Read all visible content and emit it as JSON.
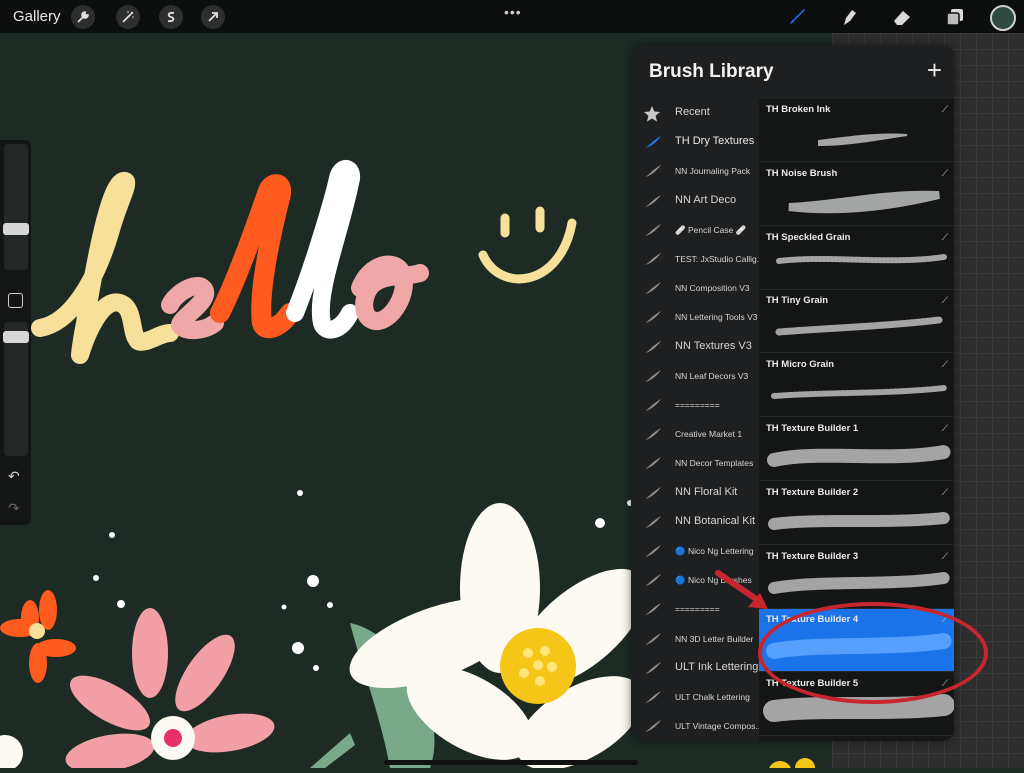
{
  "topbar": {
    "gallery_label": "Gallery",
    "left_icons": [
      "wrench-icon",
      "magic-wand-icon",
      "selection-s-icon",
      "transform-arrow-icon"
    ],
    "more_label": "•••",
    "right_icons": [
      "brush-icon",
      "smudge-icon",
      "eraser-icon",
      "layers-icon"
    ],
    "current_color": "#2f4a40",
    "active_tool_color": "#1f7bf2"
  },
  "canvas": {
    "lettering": "hello",
    "background": "#1d2b24"
  },
  "brush_library": {
    "title": "Brush Library",
    "add_label": "+",
    "sets": [
      {
        "label": "Recent",
        "icon": "star-icon",
        "active": false,
        "size": "big"
      },
      {
        "label": "TH Dry Textures",
        "icon": "brush-stroke-icon",
        "active": true,
        "size": "big"
      },
      {
        "label": "NN Journaling Pack",
        "icon": "brush-stroke-icon",
        "active": false,
        "size": "small"
      },
      {
        "label": "NN Art Deco",
        "icon": "brush-stroke-icon",
        "active": false,
        "size": "big"
      },
      {
        "label": "🩹 Pencil Case 🩹",
        "icon": "brush-stroke-icon",
        "active": false,
        "size": "small"
      },
      {
        "label": "TEST: JxStudio Callig...",
        "icon": "brush-stroke-icon",
        "active": false,
        "size": "small"
      },
      {
        "label": "NN Composition V3",
        "icon": "brush-stroke-icon",
        "active": false,
        "size": "small"
      },
      {
        "label": "NN Lettering Tools V3",
        "icon": "brush-stroke-icon",
        "active": false,
        "size": "small"
      },
      {
        "label": "NN Textures V3",
        "icon": "brush-stroke-icon",
        "active": false,
        "size": "big"
      },
      {
        "label": "NN Leaf Decors V3",
        "icon": "brush-stroke-icon",
        "active": false,
        "size": "small"
      },
      {
        "label": "=========",
        "icon": "brush-stroke-icon",
        "active": false,
        "size": "small"
      },
      {
        "label": "Creative Market 1",
        "icon": "brush-stroke-icon",
        "active": false,
        "size": "small"
      },
      {
        "label": "NN Decor Templates",
        "icon": "brush-stroke-icon",
        "active": false,
        "size": "small"
      },
      {
        "label": "NN Floral Kit",
        "icon": "brush-stroke-icon",
        "active": false,
        "size": "big"
      },
      {
        "label": "NN Botanical Kit",
        "icon": "brush-stroke-icon",
        "active": false,
        "size": "big"
      },
      {
        "label": "🔵 Nico Ng Lettering",
        "icon": "brush-stroke-icon",
        "active": false,
        "size": "small"
      },
      {
        "label": "🔵 Nico Ng Brushes",
        "icon": "brush-stroke-icon",
        "active": false,
        "size": "small"
      },
      {
        "label": "=========",
        "icon": "brush-stroke-icon",
        "active": false,
        "size": "small"
      },
      {
        "label": "NN 3D Letter Builder",
        "icon": "brush-stroke-icon",
        "active": false,
        "size": "small"
      },
      {
        "label": "ULT Ink Lettering",
        "icon": "brush-stroke-icon",
        "active": false,
        "size": "big"
      },
      {
        "label": "ULT Chalk Lettering",
        "icon": "brush-stroke-icon",
        "active": false,
        "size": "small"
      },
      {
        "label": "ULT Vintage Compos...",
        "icon": "brush-stroke-icon",
        "active": false,
        "size": "small"
      }
    ],
    "brushes": [
      {
        "name": "TH Broken Ink",
        "selected": false
      },
      {
        "name": "TH Noise Brush",
        "selected": false
      },
      {
        "name": "TH Speckled Grain",
        "selected": false
      },
      {
        "name": "TH Tiny Grain",
        "selected": false
      },
      {
        "name": "TH Micro Grain",
        "selected": false
      },
      {
        "name": "TH Texture Builder 1",
        "selected": false
      },
      {
        "name": "TH Texture Builder 2",
        "selected": false
      },
      {
        "name": "TH Texture Builder 3",
        "selected": false
      },
      {
        "name": "TH Texture Builder 4",
        "selected": true
      },
      {
        "name": "TH Texture Builder 5",
        "selected": false
      }
    ],
    "highlight_color": "#1a73e8"
  },
  "annotation": {
    "arrow_color": "#c8262e",
    "circle_color": "#c8262e"
  }
}
